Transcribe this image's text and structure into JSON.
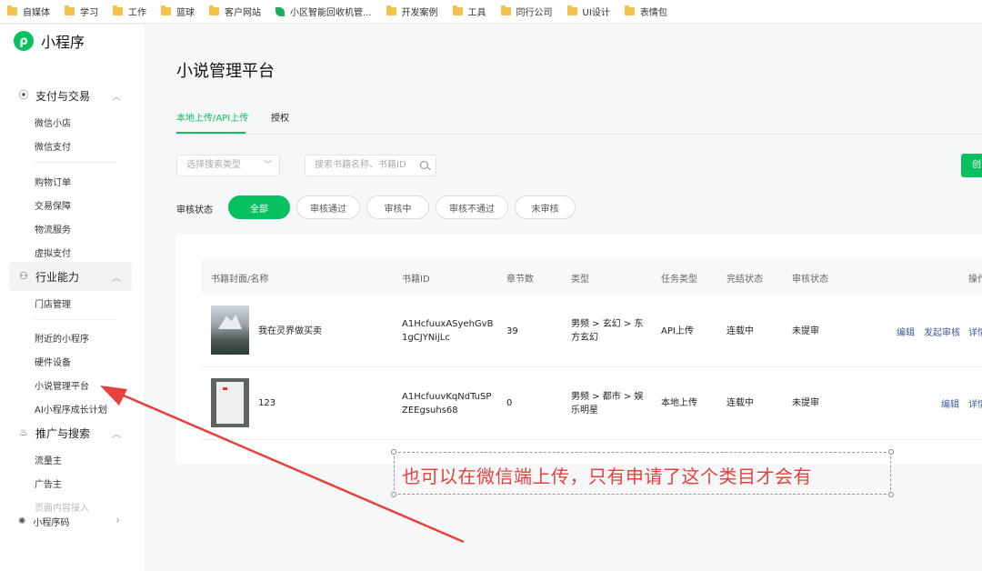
{
  "bookmarks": [
    {
      "label": "自媒体",
      "icon": "folder-icon"
    },
    {
      "label": "学习",
      "icon": "folder-icon"
    },
    {
      "label": "工作",
      "icon": "folder-icon"
    },
    {
      "label": "篮球",
      "icon": "folder-icon"
    },
    {
      "label": "客户网站",
      "icon": "folder-icon"
    },
    {
      "label": "小区智能回收机管...",
      "icon": "leaf-icon"
    },
    {
      "label": "开发案例",
      "icon": "folder-icon"
    },
    {
      "label": "工具",
      "icon": "folder-icon"
    },
    {
      "label": "同行公司",
      "icon": "folder-icon"
    },
    {
      "label": "UI设计",
      "icon": "folder-icon"
    },
    {
      "label": "表情包",
      "icon": "folder-icon"
    }
  ],
  "sidebar": {
    "brand": "小程序",
    "groups": [
      {
        "label": "支付与交易",
        "icon": "payment-icon",
        "items": [
          "微信小店",
          "微信支付",
          "购物订单",
          "交易保障",
          "物流服务",
          "虚拟支付"
        ]
      },
      {
        "label": "行业能力",
        "icon": "industry-icon",
        "items": [
          "门店管理",
          "附近的小程序",
          "硬件设备",
          "小说管理平台",
          "AI小程序成长计划"
        ]
      },
      {
        "label": "推广与搜索",
        "icon": "promotion-icon",
        "items": [
          "流量主",
          "广告主",
          "页面内容接入"
        ]
      }
    ],
    "footer": "小程序码"
  },
  "main": {
    "title": "小说管理平台",
    "tabs": [
      "本地上传/API上传",
      "授权"
    ],
    "search_type_placeholder": "选择搜索类型",
    "search_placeholder": "搜索书籍名称、书籍ID",
    "create_label": "创",
    "filter_label": "审核状态",
    "filters": [
      "全部",
      "审核通过",
      "审核中",
      "审核不通过",
      "未审核"
    ],
    "columns": [
      "书籍封面/名称",
      "书籍ID",
      "章节数",
      "类型",
      "任务类型",
      "完结状态",
      "审核状态",
      "操作"
    ],
    "rows": [
      {
        "name": "我在灵界做买卖",
        "id_line1": "A1HcfuuxASyehGvB",
        "id_line2": "1gCJYNijLc",
        "chapters": "39",
        "type_line1": "男频 > 玄幻 > 东",
        "type_line2": "方玄幻",
        "task": "API上传",
        "status": "连载中",
        "review": "未提审",
        "actions": [
          "编辑",
          "发起审核",
          "详情"
        ]
      },
      {
        "name": "123",
        "id_line1": "A1HcfuuvKqNdTuSP",
        "id_line2": "ZEEgsuhs68",
        "chapters": "0",
        "type_line1": "男频 > 都市 > 娱",
        "type_line2": "乐明星",
        "task": "本地上传",
        "status": "连载中",
        "review": "未提审",
        "actions": [
          "编辑",
          "详情"
        ]
      }
    ]
  },
  "annotation": {
    "text": "也可以在微信端上传，只有申请了这个类目才会有",
    "color": "#e8403c"
  },
  "colors": {
    "accent": "#07c160",
    "link": "#3c5a99"
  }
}
